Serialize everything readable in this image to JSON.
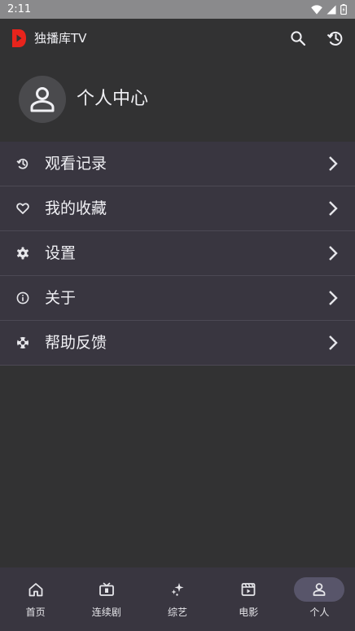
{
  "status_bar": {
    "time": "2:11",
    "icons": [
      "wifi-icon",
      "signal-icon",
      "battery-icon"
    ]
  },
  "app_bar": {
    "title": "独播库TV",
    "logo_color": "#e8241c",
    "actions": [
      "search-icon",
      "history-icon"
    ]
  },
  "profile": {
    "name": "个人中心",
    "avatar_icon": "person-icon"
  },
  "menu": {
    "items": [
      {
        "label": "观看记录",
        "icon": "history-icon"
      },
      {
        "label": "我的收藏",
        "icon": "heart-icon"
      },
      {
        "label": "设置",
        "icon": "gear-icon"
      },
      {
        "label": "关于",
        "icon": "info-icon"
      },
      {
        "label": "帮助反馈",
        "icon": "lifebuoy-icon"
      }
    ]
  },
  "bottom_nav": {
    "items": [
      {
        "label": "首页",
        "icon": "home-icon"
      },
      {
        "label": "连续剧",
        "icon": "tv-icon"
      },
      {
        "label": "综艺",
        "icon": "sparkle-icon"
      },
      {
        "label": "电影",
        "icon": "movie-icon"
      },
      {
        "label": "个人",
        "icon": "person-icon"
      }
    ],
    "active": "个人"
  },
  "colors": {
    "background": "#323233",
    "surface": "#393640",
    "active_pill": "#58556a",
    "status_bar": "#8a8a8c"
  }
}
